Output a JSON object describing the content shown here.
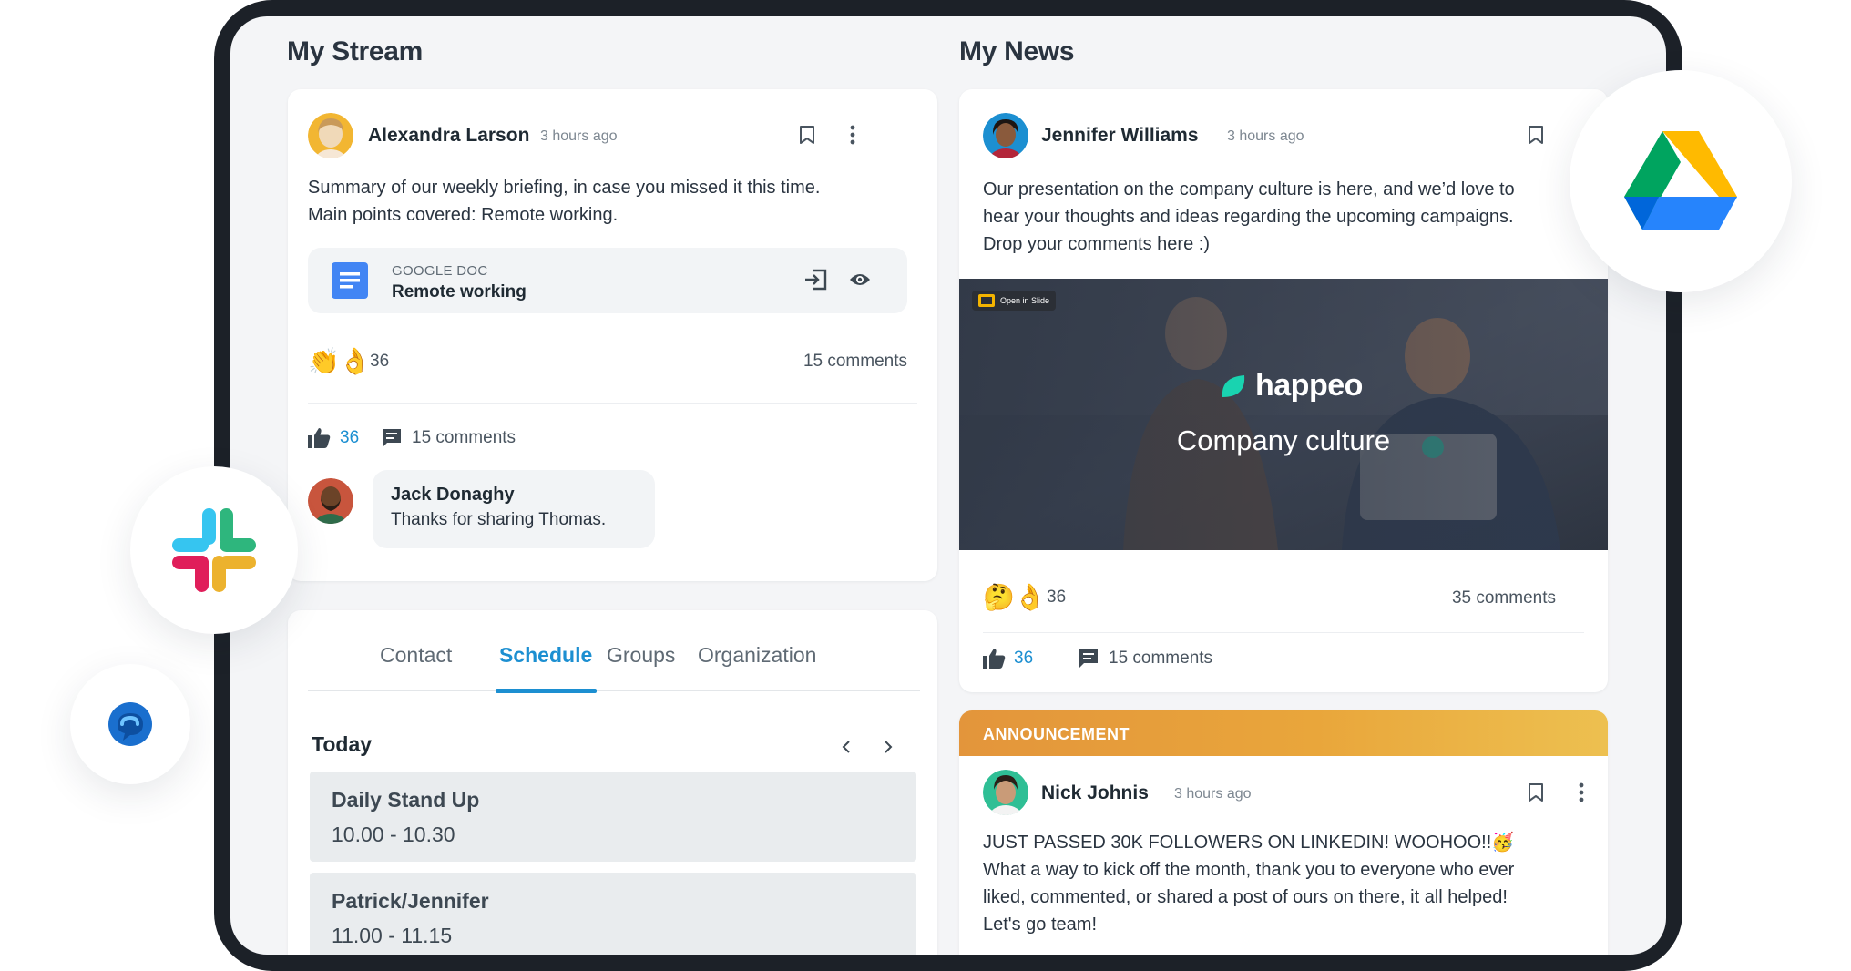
{
  "stream": {
    "title": "My Stream",
    "post": {
      "author": "Alexandra Larson",
      "time": "3 hours ago",
      "text_line1": "Summary of our weekly briefing, in case you missed it this time.",
      "text_line2": "Main points covered: Remote working.",
      "attachment": {
        "type": "GOOGLE DOC",
        "title": "Remote working"
      },
      "reactions_count": "36",
      "comments_label": "15 comments",
      "likes": "36",
      "comment_action": "15 comments",
      "comment": {
        "author": "Jack Donaghy",
        "text": "Thanks for sharing Thomas."
      }
    },
    "tabs": [
      "Contact",
      "Schedule",
      "Groups",
      "Organization"
    ],
    "active_tab": "Schedule",
    "day_label": "Today",
    "schedule": [
      {
        "title": "Daily Stand Up",
        "time": "10.00 - 10.30"
      },
      {
        "title": "Patrick/Jennifer",
        "time": "11.00 - 11.15"
      }
    ]
  },
  "news": {
    "title": "My News",
    "post": {
      "author": "Jennifer Williams",
      "time": "3 hours ago",
      "text_line1": "Our presentation on the company culture is here, and we’d love to",
      "text_line2": "hear your thoughts and ideas regarding the upcoming campaigns.",
      "text_line3": "Drop your comments here :)",
      "media_badge": "Open in Slide",
      "media_brand": "happeo",
      "media_caption": "Company culture",
      "reactions_count": "36",
      "comments_label": "35 comments",
      "likes": "36",
      "comment_action": "15 comments"
    },
    "announcement": {
      "label": "ANNOUNCEMENT",
      "author": "Nick Johnis",
      "time": "3 hours ago",
      "text_line1": "JUST PASSED 30K FOLLOWERS ON LINKEDIN! WOOHOO!!🥳",
      "text_line2": "What a way to kick off the month, thank you to everyone who ever",
      "text_line3": "liked, commented, or shared a post of ours on there, it all helped!",
      "text_line4": "Let's go team!"
    }
  },
  "colors": {
    "accent": "#1c8fd1",
    "announcement": "#e9a63b",
    "frame": "#1c2128"
  },
  "icons": [
    "bookmark-icon",
    "more-vertical-icon",
    "google-doc-icon",
    "open-external-icon",
    "eye-icon",
    "thumbs-up-icon",
    "comment-icon",
    "chevron-left-icon",
    "chevron-right-icon",
    "google-drive-logo",
    "slack-logo",
    "happeo-chat-logo"
  ]
}
